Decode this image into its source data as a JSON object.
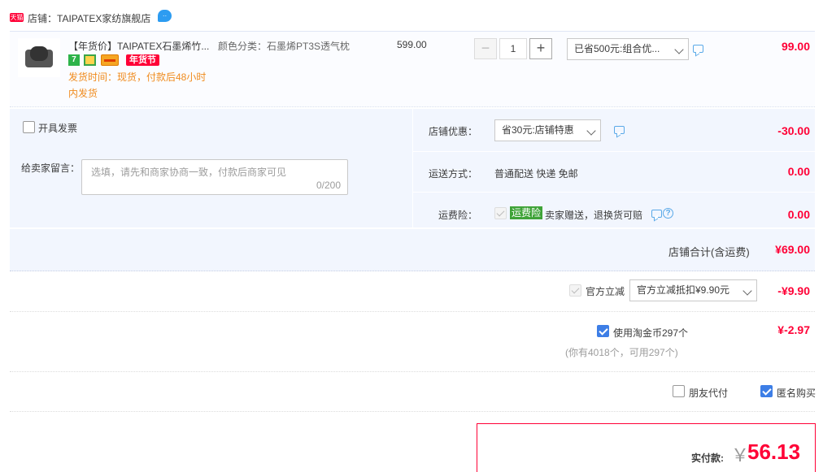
{
  "shop": {
    "tmall_badge": "天猫",
    "label": "店铺：TAIPATEX家纺旗舰店",
    "ww_icon": "wangwang-chat-icon"
  },
  "item": {
    "title": "【年货价】TAIPATEX石墨烯竹...",
    "sku": "颜色分类：石墨烯PT3S透气枕",
    "unit_price": "599.00",
    "badges": {
      "seven": "7",
      "nianhuojie": "年货节"
    },
    "ship_time": "发货时间：现货，付款后48小时",
    "ship_time_2": "内发货",
    "quantity": "1",
    "minus": "−",
    "plus": "+",
    "promo_select": "已省500元:组合优...",
    "total": "99.00"
  },
  "invoice": {
    "label": "开具发票"
  },
  "message": {
    "label": "给卖家留言：",
    "placeholder": "选填，请先和商家协商一致，付款后商家可见",
    "counter": "0/200"
  },
  "shop_discount": {
    "label": "店铺优惠：",
    "select": "省30元:店铺特惠",
    "value": "-30.00"
  },
  "shipping": {
    "label": "运送方式：",
    "text": "普通配送 快递 免邮",
    "value": "0.00"
  },
  "insurance": {
    "label": "运费险：",
    "tag": "运费险",
    "text": "卖家赠送，退换货可赔",
    "value": "0.00",
    "help": "?"
  },
  "subtotal": {
    "label": "店铺合计(含运费)",
    "value": "¥69.00"
  },
  "official_discount": {
    "label": "官方立减",
    "select": "官方立减抵扣¥9.90元",
    "value": "-¥9.90"
  },
  "coins": {
    "label": "使用淘金币297个",
    "sub": "(你有4018个，可用297个)",
    "value": "¥-2.97"
  },
  "options": {
    "friend_pay": "朋友代付",
    "anonymous": "匿名购买"
  },
  "pay": {
    "label": "实付款:",
    "currency": "￥",
    "amount": "56.13"
  },
  "colors": {
    "accent_red": "#ff0036",
    "panel_blue": "#f2f6fe",
    "checkbox_blue": "#3d7ee6",
    "orange_text": "#f08b1d"
  }
}
